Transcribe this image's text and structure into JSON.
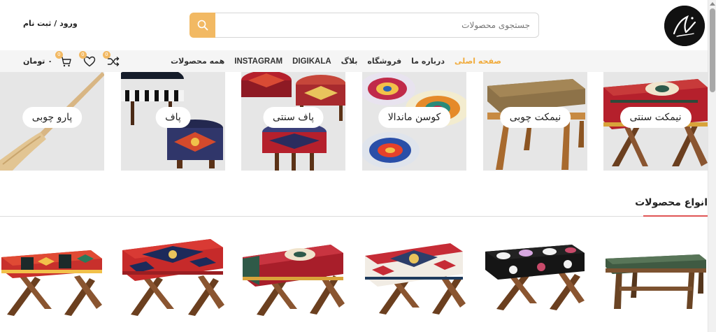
{
  "header": {
    "logo_icon": "brand-logo",
    "search": {
      "placeholder": "جستجوی محصولات",
      "value": "",
      "icon": "search-icon"
    },
    "login_label": "ورود / ثبت نام"
  },
  "nav": {
    "items": [
      {
        "label": "صفحه اصلی",
        "active": true
      },
      {
        "label": "درباره ما",
        "active": false
      },
      {
        "label": "فروشگاه",
        "active": false
      },
      {
        "label": "بلاگ",
        "active": false
      },
      {
        "label": "DIGIKALA",
        "active": false
      },
      {
        "label": "INSTAGRAM",
        "active": false
      },
      {
        "label": "همه محصولات",
        "active": false
      }
    ],
    "cart_total": "۰ تومان",
    "cart_count": "0",
    "wishlist_count": "0",
    "compare_count": "0"
  },
  "categories": [
    {
      "label": "نیمکت سنتی",
      "icon": "kilim-bench-image"
    },
    {
      "label": "نیمکت چوبی",
      "icon": "wooden-bench-image"
    },
    {
      "label": "کوسن ماندالا",
      "icon": "mandala-cushion-image"
    },
    {
      "label": "پاف سنتی",
      "icon": "traditional-pouf-image"
    },
    {
      "label": "پاف",
      "icon": "pouf-image"
    },
    {
      "label": "پارو چوبی",
      "icon": "wooden-paddle-image"
    }
  ],
  "section": {
    "title": "انواع محصولات"
  },
  "products": [
    {
      "icon": "green-cushion-bench-image"
    },
    {
      "icon": "paisley-bench-image"
    },
    {
      "icon": "kilim-bench-image"
    },
    {
      "icon": "medallion-bench-image"
    },
    {
      "icon": "carpet-bench-image"
    },
    {
      "icon": "red-kilim-bench-image"
    }
  ],
  "colors": {
    "accent": "#f2b963",
    "active_nav": "#f0ab3c",
    "section_underline": "#e05555",
    "nav_background": "#f5f5f5",
    "tile_background": "#e6e6e6"
  }
}
